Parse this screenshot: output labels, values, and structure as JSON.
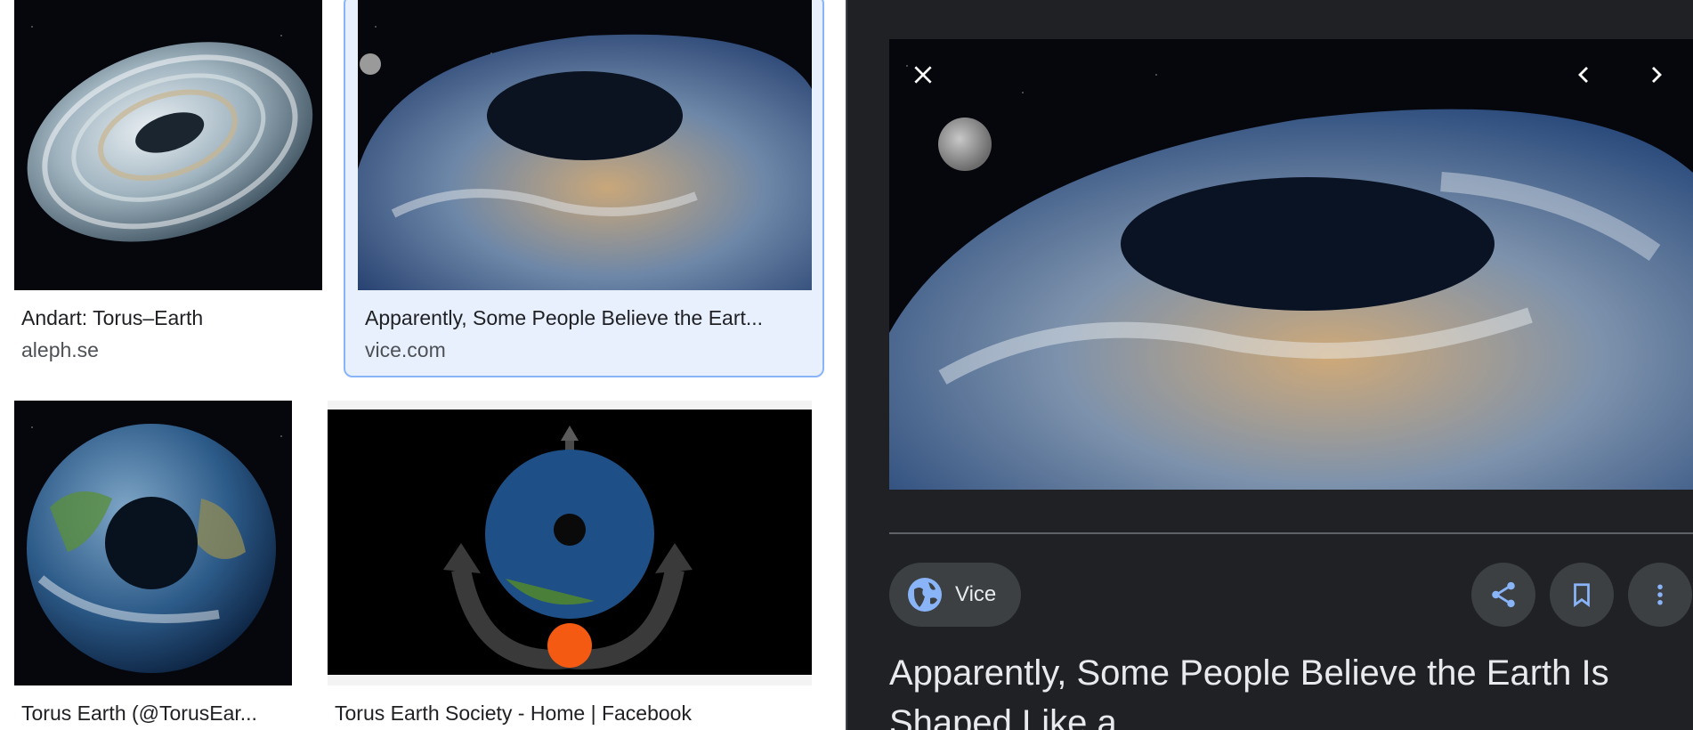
{
  "results": [
    {
      "title": "Andart: Torus–Earth",
      "source": "aleph.se"
    },
    {
      "title": "Apparently, Some People Believe the Eart...",
      "source": "vice.com"
    },
    {
      "title": "Torus Earth (@TorusEar...",
      "source": ""
    },
    {
      "title": "Torus Earth Society - Home | Facebook",
      "source": ""
    }
  ],
  "viewer": {
    "source_name": "Vice",
    "title": "Apparently, Some People Believe the Earth Is Shaped Like a",
    "icons": {
      "close": "close-icon",
      "prev": "chevron-left-icon",
      "next": "chevron-right-icon",
      "source": "globe-icon",
      "share": "share-icon",
      "save": "bookmark-icon",
      "more": "more-vert-icon"
    }
  },
  "colors": {
    "viewer_bg": "#202124",
    "selected_bg": "#e8f0fe",
    "selected_border": "#8ab4f8",
    "accent": "#8ab4f8"
  }
}
